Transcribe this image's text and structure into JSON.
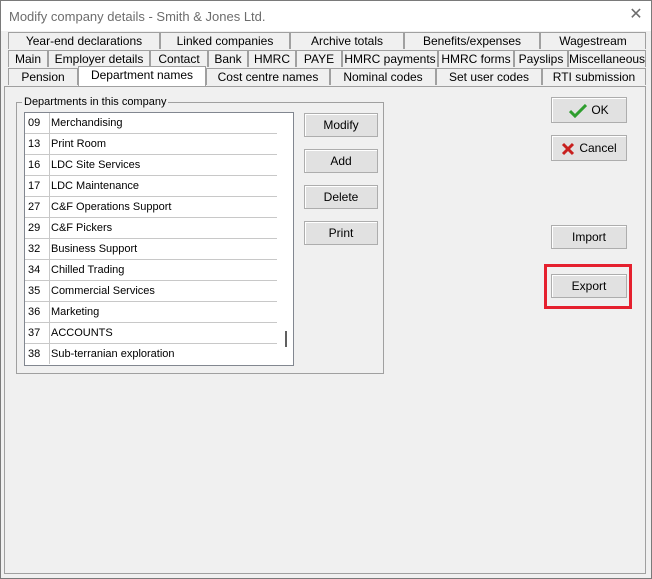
{
  "window": {
    "title": "Modify company details - Smith & Jones Ltd.",
    "close_glyph": "✕"
  },
  "tabs": {
    "row1": [
      "Year-end declarations",
      "Linked companies",
      "Archive totals",
      "Benefits/expenses",
      "Wagestream"
    ],
    "row2": [
      "Main",
      "Employer details",
      "Contact",
      "Bank",
      "HMRC",
      "PAYE",
      "HMRC payments",
      "HMRC forms",
      "Payslips",
      "Miscellaneous"
    ],
    "row3": [
      "Pension",
      "Department names",
      "Cost centre names",
      "Nominal codes",
      "Set user codes",
      "RTI submission"
    ],
    "active": "Department names"
  },
  "departments": {
    "group_label": "Departments in this company",
    "rows": [
      {
        "code": "09",
        "name": "Merchandising"
      },
      {
        "code": "13",
        "name": "Print Room"
      },
      {
        "code": "16",
        "name": "LDC Site Services"
      },
      {
        "code": "17",
        "name": "LDC Maintenance"
      },
      {
        "code": "27",
        "name": "C&F Operations Support"
      },
      {
        "code": "29",
        "name": "C&F Pickers"
      },
      {
        "code": "32",
        "name": "Business Support"
      },
      {
        "code": "34",
        "name": "Chilled Trading"
      },
      {
        "code": "35",
        "name": "Commercial Services"
      },
      {
        "code": "36",
        "name": "Marketing"
      },
      {
        "code": "37",
        "name": "ACCOUNTS"
      },
      {
        "code": "38",
        "name": "Sub-terranian exploration"
      }
    ]
  },
  "buttons": {
    "modify": "Modify",
    "add": "Add",
    "delete": "Delete",
    "print": "Print",
    "ok": "OK",
    "cancel": "Cancel",
    "import": "Import",
    "export": "Export"
  },
  "colors": {
    "highlight": "#e5202e",
    "ok_check": "#2e9e2e",
    "cancel_x": "#c8201e"
  },
  "icons": {
    "ok": "check-icon",
    "cancel": "cross-icon"
  }
}
